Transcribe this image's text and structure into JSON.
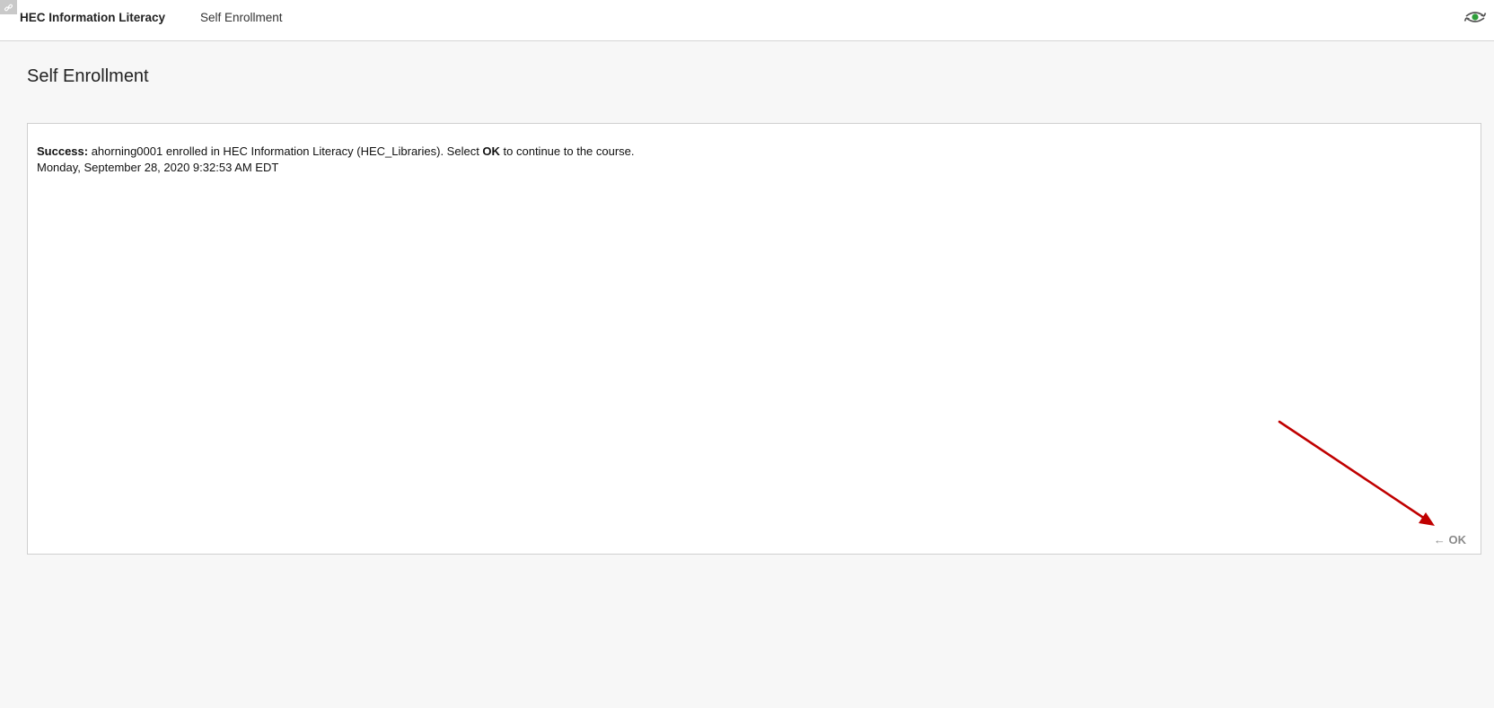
{
  "header": {
    "course_title": "HEC Information Literacy",
    "breadcrumb": "Self Enrollment",
    "preview_icon": "student-preview-icon",
    "corner_icon": "link-icon"
  },
  "page": {
    "title": "Self Enrollment"
  },
  "message": {
    "status_label": "Success:",
    "text_before_ok": " ahorning0001 enrolled in HEC Information Literacy (HEC_Libraries). Select ",
    "ok_word": "OK",
    "text_after_ok": " to continue to the course.",
    "timestamp": "Monday, September 28, 2020 9:32:53 AM EDT"
  },
  "actions": {
    "ok_label": "OK",
    "ok_prefix": "←"
  },
  "colors": {
    "annotation_arrow": "#c00000",
    "preview_icon_green": "#2e9e3a"
  }
}
